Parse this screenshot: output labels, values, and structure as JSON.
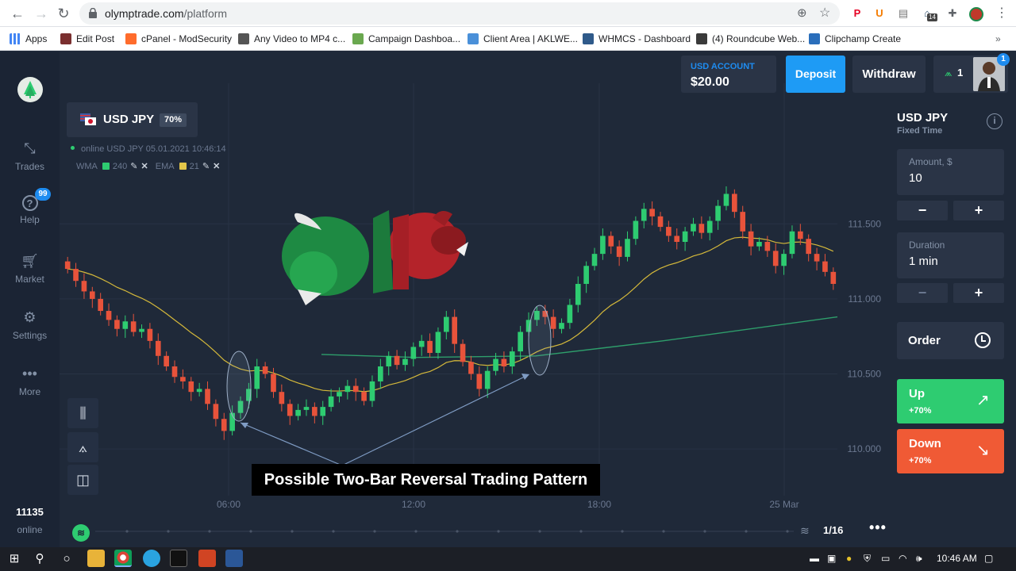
{
  "browser": {
    "url_host": "olymptrade.com",
    "url_path": "/platform",
    "ext_badge": "14",
    "bookmarks": [
      {
        "label": "Apps",
        "color": "#4285f4"
      },
      {
        "label": "Edit Post",
        "color": "#7a2f2f"
      },
      {
        "label": "cPanel - ModSecurity",
        "color": "#ff6c2c"
      },
      {
        "label": "Any Video to MP4 c...",
        "color": "#555555"
      },
      {
        "label": "Campaign Dashboa...",
        "color": "#6aa84f"
      },
      {
        "label": "Client Area | AKLWE...",
        "color": "#4a90d9"
      },
      {
        "label": "WHMCS - Dashboard",
        "color": "#2f5a8a"
      },
      {
        "label": "(4) Roundcube Web...",
        "color": "#3a3a3a"
      },
      {
        "label": "Clipchamp Create",
        "color": "#2a6ebb"
      }
    ]
  },
  "sidebar": {
    "items": [
      {
        "label": "Trades",
        "icon": "trades-arrows-icon"
      },
      {
        "label": "Help",
        "icon": "help-icon"
      },
      {
        "label": "Market",
        "icon": "cart-icon"
      },
      {
        "label": "Settings",
        "icon": "gear-icon"
      },
      {
        "label": "More",
        "icon": "dots-icon"
      }
    ],
    "help_badge": "99",
    "online_count": "11135",
    "online_label": "online"
  },
  "header": {
    "account_label": "USD ACCOUNT",
    "balance": "$20.00",
    "deposit": "Deposit",
    "withdraw": "Withdraw",
    "level": "1",
    "notif_badge": "1"
  },
  "asset": {
    "name": "USD JPY",
    "payout": "70%",
    "online_info": "online USD JPY  05.01.2021 10:46:14",
    "wma_label": "WMA",
    "wma_value": "240",
    "wma_color": "#2ecc71",
    "ema_label": "EMA",
    "ema_value": "21",
    "ema_color": "#e3c649"
  },
  "chart": {
    "caption": "Possible Two-Bar Reversal Trading Pattern",
    "page_indicator": "1/16",
    "colors": {
      "up": "#2ecc71",
      "down": "#e8533b",
      "ema": "#d4b83a",
      "wma": "#2e9e6b"
    }
  },
  "chart_data": {
    "type": "candlestick",
    "y_ticks": [
      "111.500",
      "111.000",
      "110.500",
      "110.000"
    ],
    "x_ticks": [
      "06:00",
      "12:00",
      "18:00",
      "25 Mar"
    ],
    "ylim": [
      109.9,
      111.75
    ],
    "close_series": [
      111.2,
      111.12,
      111.05,
      111.0,
      110.92,
      110.86,
      110.8,
      110.85,
      110.78,
      110.8,
      110.72,
      110.62,
      110.55,
      110.48,
      110.45,
      110.38,
      110.4,
      110.3,
      110.2,
      110.12,
      110.24,
      110.32,
      110.4,
      110.55,
      110.5,
      110.38,
      110.3,
      110.22,
      110.26,
      110.28,
      110.22,
      110.28,
      110.35,
      110.38,
      110.42,
      110.38,
      110.32,
      110.45,
      110.55,
      110.62,
      110.56,
      110.6,
      110.68,
      110.72,
      110.64,
      110.78,
      110.88,
      110.7,
      110.58,
      110.5,
      110.4,
      110.52,
      110.6,
      110.55,
      110.65,
      110.78,
      110.86,
      110.92,
      110.88,
      110.8,
      110.84,
      110.96,
      111.1,
      111.22,
      111.3,
      111.42,
      111.35,
      111.28,
      111.4,
      111.52,
      111.6,
      111.55,
      111.48,
      111.42,
      111.38,
      111.45,
      111.5,
      111.44,
      111.52,
      111.62,
      111.7,
      111.58,
      111.45,
      111.35,
      111.38,
      111.32,
      111.22,
      111.3,
      111.45,
      111.4,
      111.3,
      111.25,
      111.18,
      111.1
    ]
  },
  "panel": {
    "title": "USD JPY",
    "subtitle": "Fixed Time",
    "amount_label": "Amount, $",
    "amount_value": "10",
    "duration_label": "Duration",
    "duration_value": "1 min",
    "order": "Order",
    "up_label": "Up",
    "up_pct": "+70%",
    "up_color": "#2ecc71",
    "down_label": "Down",
    "down_pct": "+70%",
    "down_color": "#f05a35"
  },
  "taskbar": {
    "time": "10:46 AM"
  }
}
